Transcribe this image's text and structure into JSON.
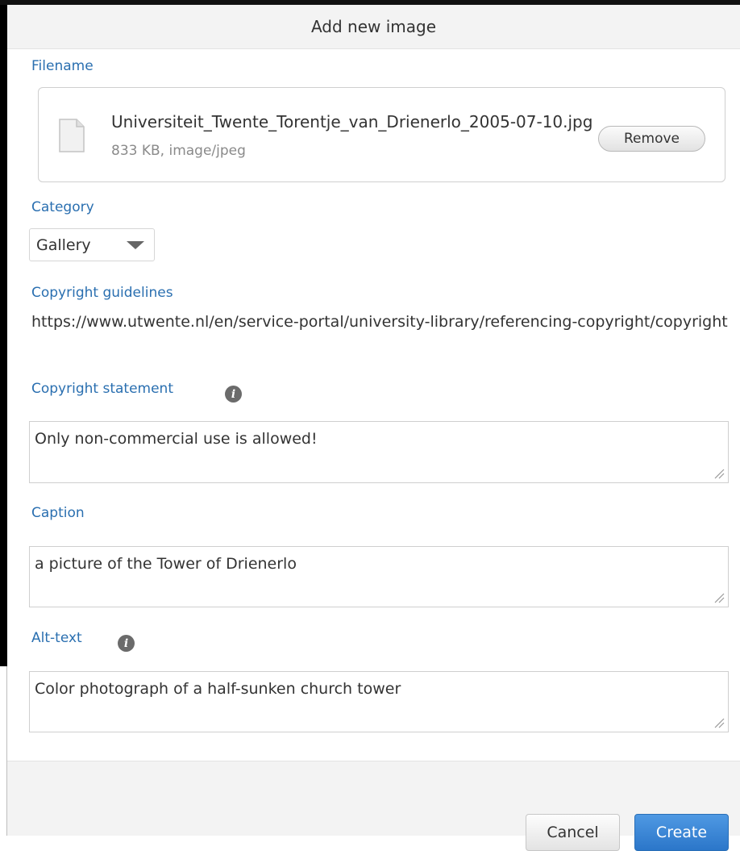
{
  "dialog": {
    "title": "Add new image"
  },
  "filename": {
    "label": "Filename",
    "file_name": "Universiteit_Twente_Torentje_van_Drienerlo_2005-07-10.jpg",
    "file_meta": "833 KB, image/jpeg",
    "remove_label": "Remove",
    "icon": "file-icon"
  },
  "category": {
    "label": "Category",
    "selected": "Gallery"
  },
  "guidelines": {
    "label": "Copyright guidelines",
    "text": "https://www.utwente.nl/en/service-portal/university-library/referencing-copyright/copyright"
  },
  "copyright_statement": {
    "label": "Copyright statement",
    "value": "Only non-commercial use is allowed!",
    "icon": "info-icon"
  },
  "caption": {
    "label": "Caption",
    "value": "a picture of the Tower of Drienerlo"
  },
  "alt_text": {
    "label": "Alt-text",
    "value": "Color photograph of a half-sunken church tower",
    "icon": "info-icon"
  },
  "footer": {
    "cancel_label": "Cancel",
    "create_label": "Create"
  },
  "colors": {
    "label_blue": "#2a6fb0",
    "primary_button": "#2b76c9"
  }
}
